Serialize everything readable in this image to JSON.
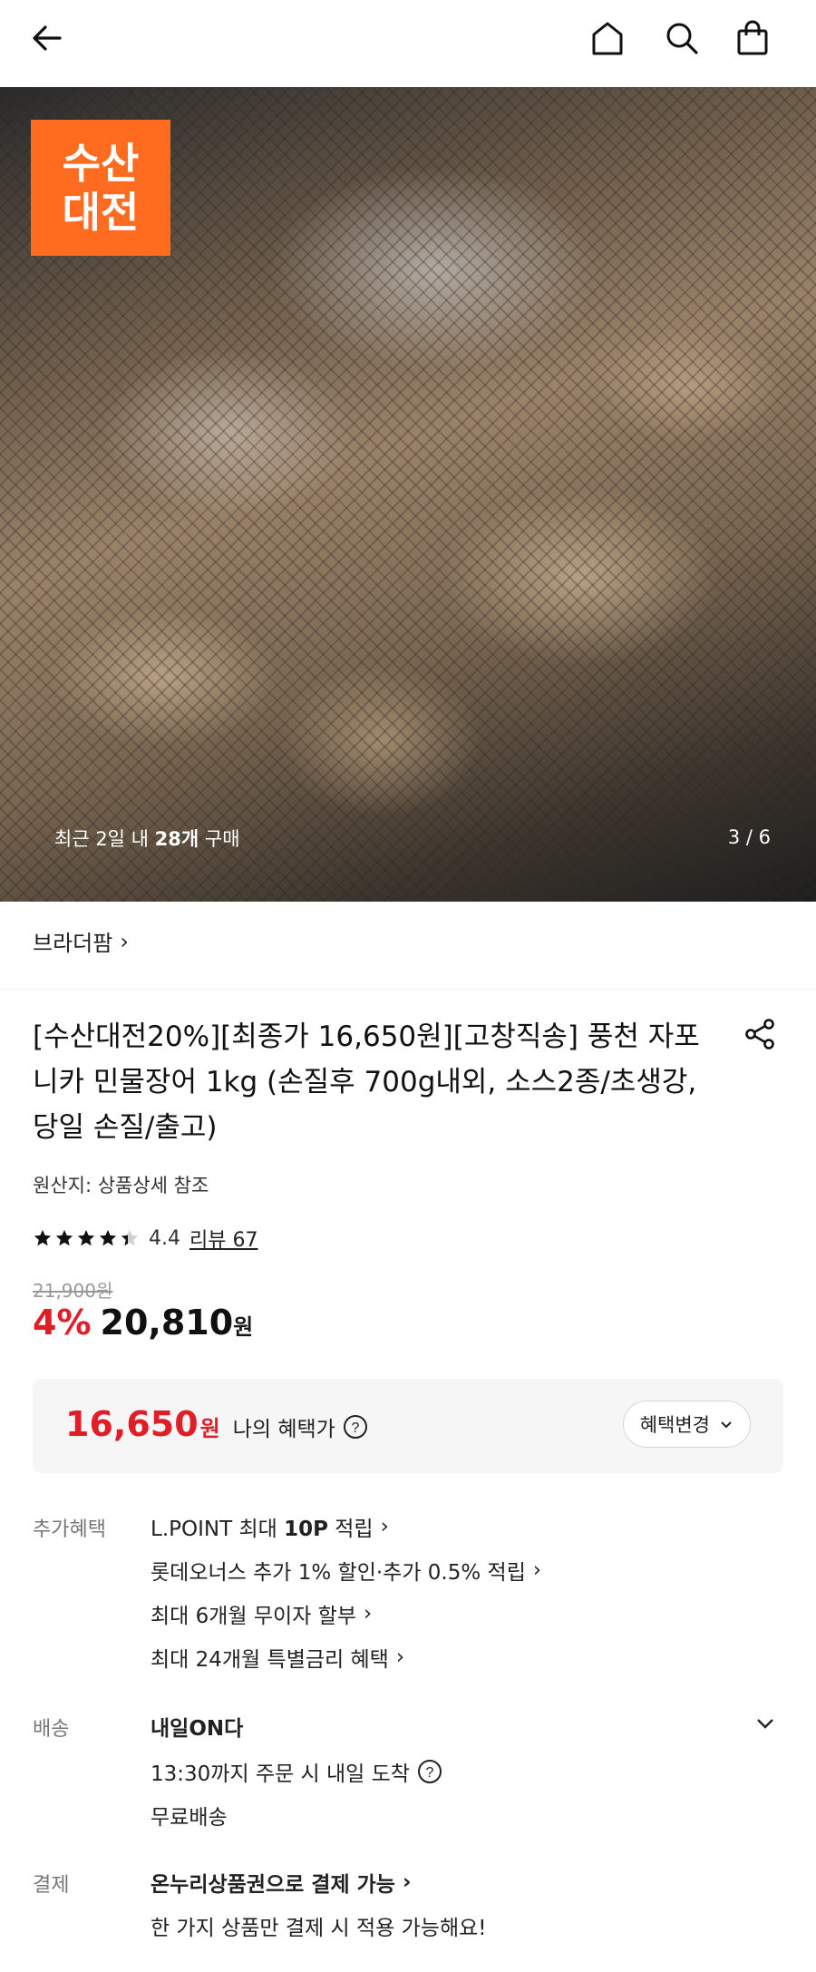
{
  "header": {
    "back_icon": "arrow-left-icon",
    "home_icon": "home-icon",
    "search_icon": "search-icon",
    "cart_icon": "shopping-bag-icon"
  },
  "gallery": {
    "badge_line1": "수산",
    "badge_line2": "대전",
    "recent_prefix": "최근 2일 내 ",
    "recent_count": "28개",
    "recent_suffix": " 구매",
    "counter": "3 / 6",
    "badge_color": "#ff6b1f"
  },
  "brand": {
    "name": "브라더팜",
    "chevron": "›"
  },
  "product": {
    "title": "[수산대전20%][최종가 16,650원][고창직송] 풍천 자포니카 민물장어 1kg (손질후 700g내외, 소스2종/초생강, 당일 손질/출고)",
    "origin": "원산지: 상품상세 참조",
    "rating_value": "4.4",
    "rating_stars": 4.4,
    "review_label": "리뷰 67",
    "original_price": "21,900원",
    "discount": "4%",
    "price": "20,810",
    "price_unit": "원"
  },
  "benefit": {
    "price": "16,650",
    "price_unit": "원",
    "label": "나의 혜택가",
    "change_button": "혜택변경",
    "accent": "#e11e28"
  },
  "extra": {
    "label": "추가혜택",
    "lines": [
      {
        "pre": "L.POINT 최대 ",
        "bold": "10P",
        "post": " 적립"
      },
      {
        "pre": "롯데오너스 추가 1% 할인·추가 0.5% 적립",
        "bold": "",
        "post": ""
      },
      {
        "pre": "최대 6개월 무이자 할부",
        "bold": "",
        "post": ""
      },
      {
        "pre": "최대 24개월 특별금리 혜택",
        "bold": "",
        "post": ""
      }
    ]
  },
  "delivery": {
    "label": "배송",
    "title": "내일ON다",
    "line1": "13:30까지 주문 시 내일 도착",
    "line2": "무료배송"
  },
  "payment": {
    "label": "결제",
    "title": "온누리상품권으로 결제 가능",
    "line1": "한 가지 상품만 결제 시 적용 가능해요!"
  }
}
